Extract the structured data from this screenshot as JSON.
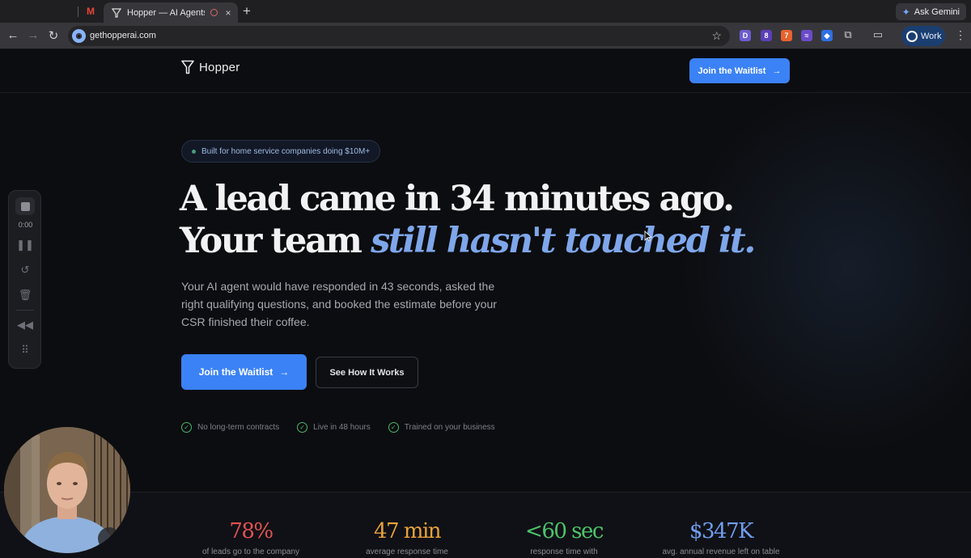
{
  "browser": {
    "gmail_tab_label": "M",
    "active_tab_title": "Hopper — AI Agents for H",
    "new_tab_label": "+",
    "close_label": "×",
    "gemini_label": "Ask Gemini",
    "url": "gethopperai.com",
    "profile_label": "Work",
    "extensions": [
      {
        "icon": "d-extension-icon",
        "glyph": "D",
        "color": "#6d5bd0"
      },
      {
        "icon": "dark-reader-extension-icon",
        "glyph": "8",
        "color": "#5b3fb8"
      },
      {
        "icon": "orange-extension-icon",
        "glyph": "7",
        "color": "#e8622f"
      },
      {
        "icon": "purple-extension-icon",
        "glyph": "≈",
        "color": "#6a4bc9"
      },
      {
        "icon": "blue-extension-icon",
        "glyph": "◆",
        "color": "#2f6fe0"
      }
    ]
  },
  "header": {
    "logo_text": "Hopper",
    "cta_label": "Join the Waitlist"
  },
  "hero": {
    "badge": "Built for home service companies doing $10M+",
    "headline_line1": "A lead came in 34 minutes ago.",
    "headline_line2_plain": "Your team ",
    "headline_line2_accent": "still hasn't touched it.",
    "subcopy": "Your AI agent would have responded in 43 seconds, asked the right qualifying questions, and booked the estimate before your CSR finished their coffee.",
    "primary_cta": "Join the Waitlist",
    "secondary_cta": "See How It Works",
    "perks": [
      "No long-term contracts",
      "Live in 48 hours",
      "Trained on your business"
    ]
  },
  "stats": [
    {
      "value": "78%",
      "label": "of leads go to the company",
      "color": "#e05252"
    },
    {
      "value": "47 min",
      "label": "average response time",
      "color": "#e8a23a"
    },
    {
      "value": "<60 sec",
      "label": "response time with",
      "color": "#4cc46a"
    },
    {
      "value": "$347K",
      "label": "avg. annual revenue left on table",
      "color": "#6f9ef0"
    }
  ],
  "recorder": {
    "time": "0:00"
  },
  "colors": {
    "accent": "#3b82f6",
    "headline_accent": "#7ea6ea"
  }
}
